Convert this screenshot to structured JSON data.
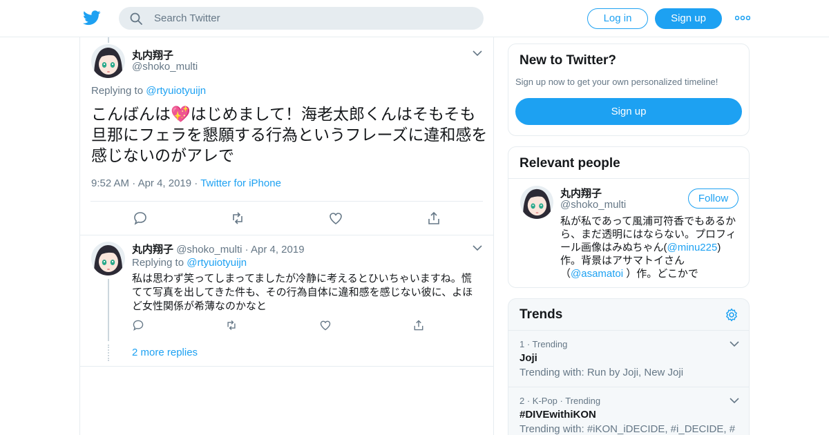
{
  "header": {
    "search_placeholder": "Search Twitter",
    "login_label": "Log in",
    "signup_label": "Sign up"
  },
  "colors": {
    "accent": "#1da1f2",
    "secondary_text": "#657786",
    "border": "#e6ecf0"
  },
  "main_tweet": {
    "name": "丸内翔子",
    "handle": "@shoko_multi",
    "replying_prefix": "Replying to",
    "replying_to": "@rtyuiotyuijn",
    "text_before_emoji": "こんばんは",
    "emoji": "💖",
    "text_after_emoji": "はじめまして！海老太郎くんはそもそも旦那にフェラを懇願する行為というフレーズに違和感を感じないのがアレで",
    "time": "9:52 AM",
    "date": "Apr 4, 2019",
    "source": "Twitter for iPhone",
    "dot": "·"
  },
  "reply_tweet": {
    "name": "丸内翔子",
    "handle": "@shoko_multi",
    "dot": "·",
    "date": "Apr 4, 2019",
    "replying_prefix": "Replying to",
    "replying_to": "@rtyuiotyuijn",
    "text": "私は思わず笑ってしまってましたが冷静に考えるとひいちゃいますね。慌てて写真を出してきた件も、その行為自体に違和感を感じない彼に、よほど女性関係が希薄なのかなと",
    "more_replies": "2 more replies"
  },
  "new_to_twitter": {
    "title": "New to Twitter?",
    "subtitle": "Sign up now to get your own personalized timeline!",
    "signup_label": "Sign up"
  },
  "relevant_people": {
    "title": "Relevant people",
    "name": "丸内翔子",
    "handle": "@shoko_multi",
    "follow_label": "Follow",
    "bio_part1": "私が私であって風浦可符香でもあるから、まだ透明にはならない。プロフィール画像はみぬちゃん(",
    "bio_link1": "@minu225",
    "bio_part2": ")作。背景はアサマトイさん（",
    "bio_link2": "@asamatoi",
    "bio_part3": " ）作。どこかで"
  },
  "trends": {
    "title": "Trends",
    "items": [
      {
        "meta": "1 · Trending",
        "name": "Joji",
        "with": "Trending with: Run by Joji, New Joji"
      },
      {
        "meta": "2 · K-Pop · Trending",
        "name": "#DIVEwithiKON",
        "with": "Trending with: #iKON_iDECIDE, #i_DECIDE, #"
      }
    ]
  }
}
